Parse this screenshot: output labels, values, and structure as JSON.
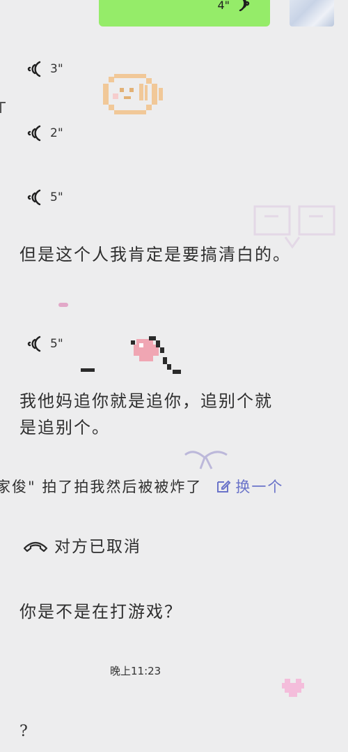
{
  "chat": {
    "sent_voice": {
      "duration": "4\""
    },
    "voice_messages": [
      {
        "duration": "3\""
      },
      {
        "duration": "2\""
      },
      {
        "duration": "5\""
      },
      {
        "duration": "5\""
      }
    ],
    "text_messages": [
      "但是这个人我肯定是要搞清白的。",
      "我他妈追你就是追你，追别个就是追别个。"
    ],
    "system_line": {
      "text": "家俊\" 拍了拍我然后被被炸了",
      "action": "换一个"
    },
    "call_status": "对方已取消",
    "question": "你是不是在打游戏？",
    "timestamp": "晚上11:23",
    "last_message": "?"
  },
  "colors": {
    "sent_bubble": "#95ec69",
    "background": "#ededee",
    "accent_link": "#6a73c9"
  },
  "icons": {
    "voice": "voice-wave-icon",
    "edit": "edit-icon",
    "phone": "phone-icon"
  }
}
